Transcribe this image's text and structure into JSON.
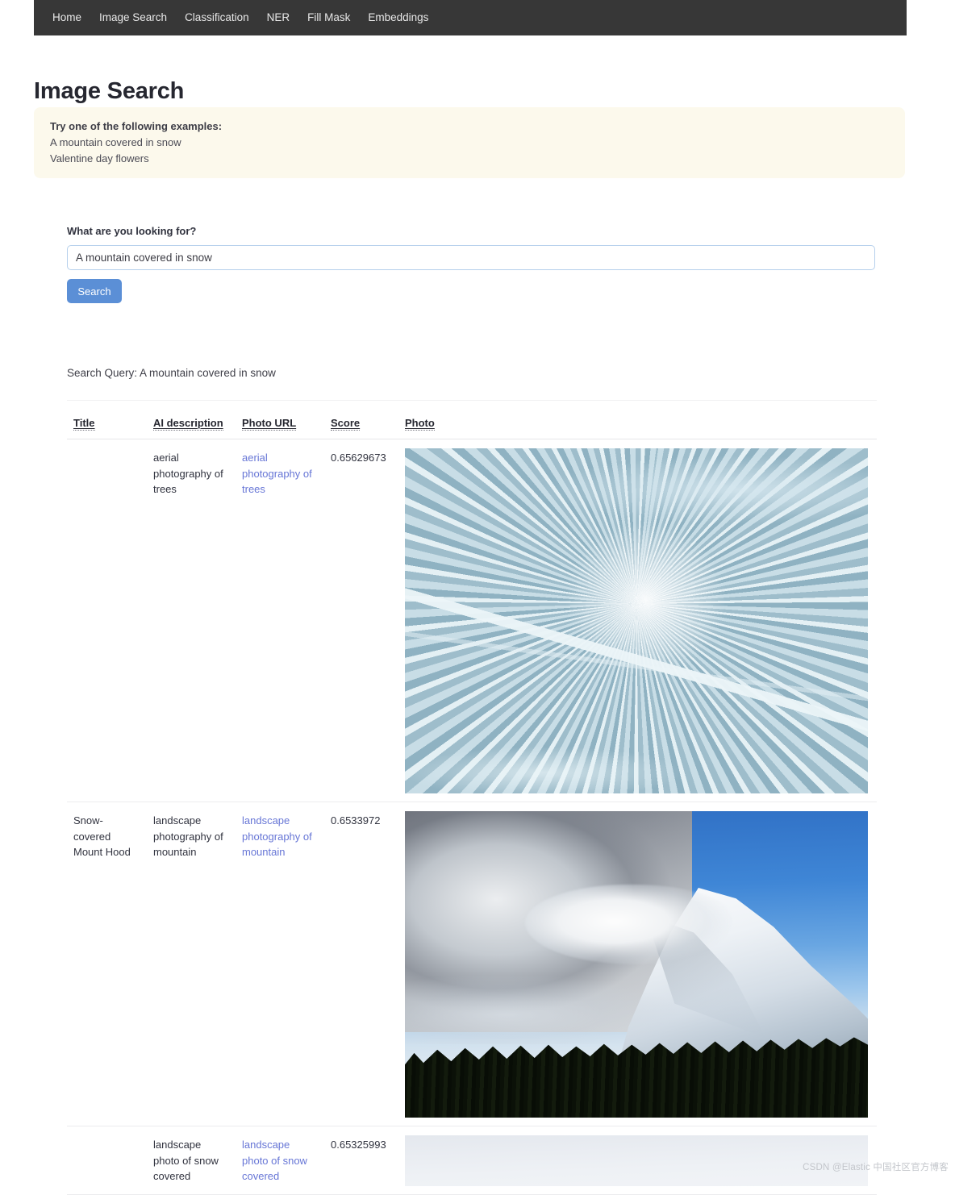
{
  "navbar": {
    "items": [
      {
        "label": "Home"
      },
      {
        "label": "Image Search"
      },
      {
        "label": "Classification"
      },
      {
        "label": "NER"
      },
      {
        "label": "Fill Mask"
      },
      {
        "label": "Embeddings"
      }
    ]
  },
  "page": {
    "title": "Image Search"
  },
  "alert": {
    "title": "Try one of the following examples:",
    "examples": [
      "A mountain covered in snow",
      "Valentine day flowers"
    ]
  },
  "form": {
    "label": "What are you looking for?",
    "input_value": "A mountain covered in snow",
    "input_placeholder": "",
    "submit_label": "Search"
  },
  "results": {
    "query_line": "Search Query: A mountain covered in snow",
    "columns": [
      "Title",
      "AI description",
      "Photo URL",
      "Score",
      "Photo"
    ],
    "rows": [
      {
        "title": "",
        "description": "aerial photography of trees",
        "photo_url": "aerial photography of trees",
        "score": "0.65629673",
        "photo_alt": "aerial photography of snow covered trees"
      },
      {
        "title": "Snow-covered Mount Hood",
        "description": "landscape photography of mountain",
        "photo_url": "landscape photography of mountain",
        "score": "0.6533972",
        "photo_alt": "snow covered Mount Hood under blue sky"
      },
      {
        "title": "",
        "description": "landscape photo of snow covered",
        "photo_url": "landscape photo of snow covered",
        "score": "0.65325993",
        "photo_alt": "pale snow covered landscape"
      }
    ]
  },
  "watermark": {
    "text": "CSDN @Elastic 中国社区官方博客"
  },
  "colors": {
    "nav_background": "#373737",
    "alert_background": "#fcf9ec",
    "primary_button": "#5b8fd6",
    "link": "#6776d6",
    "input_border": "#b6d0ec"
  }
}
